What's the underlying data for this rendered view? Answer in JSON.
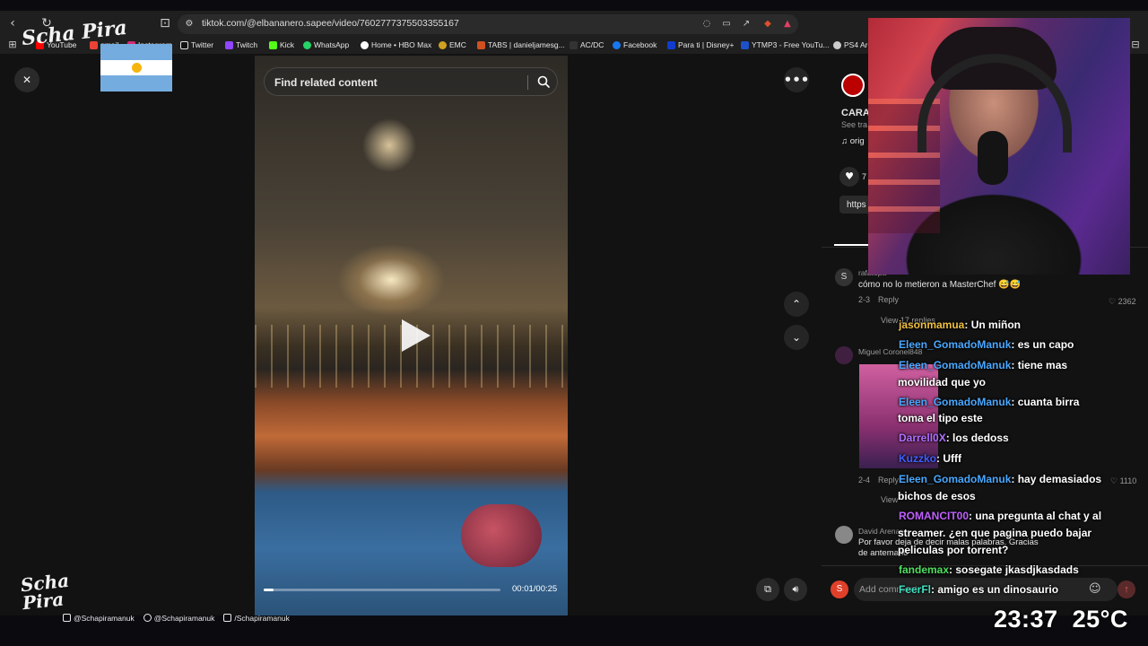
{
  "browser": {
    "url": "tiktok.com/@elbananero.sapee/video/7602777375503355167",
    "bookmarks": [
      {
        "label": "YouTube",
        "color": "#ff0000"
      },
      {
        "label": "gmail",
        "color": "#ea4335"
      },
      {
        "label": "Instagram",
        "color": "#d62976"
      },
      {
        "label": "Twitter",
        "color": "#ffffff"
      },
      {
        "label": "Twitch",
        "color": "#9146ff"
      },
      {
        "label": "Kick",
        "color": "#53fc18"
      },
      {
        "label": "WhatsApp",
        "color": "#25d366"
      },
      {
        "label": "Home • HBO Max",
        "color": "#ffffff"
      },
      {
        "label": "EMC",
        "color": "#d0a020"
      },
      {
        "label": "TABS | danieljamesg...",
        "color": "#d05020"
      },
      {
        "label": "AC/DC",
        "color": "#333333"
      },
      {
        "label": "Facebook",
        "color": "#1877f2"
      },
      {
        "label": "Para ti | Disney+",
        "color": "#113ccf"
      },
      {
        "label": "YTMP3 - Free YouTu...",
        "color": "#1e50c8"
      },
      {
        "label": "PS4 Arc",
        "color": "#cccccc"
      }
    ]
  },
  "video": {
    "search_placeholder": "Find related content",
    "time": "00:01/00:25",
    "progress": 0.04
  },
  "sidebar": {
    "creator_title": "CARA",
    "see_translation": "See tra",
    "sound": "orig",
    "likes_partial": "7",
    "link_partial": "https"
  },
  "comments": [
    {
      "user": "rafatopa",
      "avatar_letter": "S",
      "text": "cómo no lo metieron a MasterChef 😅😅",
      "meta": "2-3",
      "reply": "Reply",
      "likes": "2362",
      "view_replies": "View 17 replies"
    },
    {
      "user": "Miguel Coronel848",
      "meta": "2-4",
      "reply": "Reply",
      "likes": "1110",
      "view_replies": "View"
    },
    {
      "user": "David Arenas",
      "text": "Por favor deja de decir malas palabras. Gracias de antemano"
    }
  ],
  "add_comment_placeholder": "Add comment...",
  "add_comment_avatar": "S",
  "chat": [
    {
      "user": "jasonmamua",
      "color": "#f0c040",
      "text": ": Un miñon"
    },
    {
      "user": "Eleen_GomadoManuk",
      "color": "#4aa8ff",
      "text": ": es un capo"
    },
    {
      "user": "Eleen_GomadoManuk",
      "color": "#4aa8ff",
      "text": ": tiene mas"
    },
    {
      "user": "",
      "color": "#ffffff",
      "text": "movilidad que yo"
    },
    {
      "user": "Eleen_GomadoManuk",
      "color": "#4aa8ff",
      "text": ": cuanta birra"
    },
    {
      "user": "",
      "color": "#ffffff",
      "text": "toma el tipo este"
    },
    {
      "user": "Darrell0X",
      "color": "#b070ff",
      "text": ": los dedoss"
    },
    {
      "user": "Kuzzko",
      "color": "#4060ff",
      "text": ": Ufff"
    },
    {
      "user": "Eleen_GomadoManuk",
      "color": "#4aa8ff",
      "text": ": hay demasiados"
    },
    {
      "user": "",
      "color": "#ffffff",
      "text": "bichos de esos"
    },
    {
      "user": "ROMANCIT00",
      "color": "#c060ff",
      "text": ": una pregunta al chat y al"
    },
    {
      "user": "",
      "color": "#ffffff",
      "text": "streamer. ¿en que pagina puedo bajar"
    },
    {
      "user": "",
      "color": "#ffffff",
      "text": "peliculas por torrent?"
    },
    {
      "user": "fandemax",
      "color": "#50e060",
      "text": ": sosegate jkasdjkasdads"
    },
    {
      "user": "FeerFl",
      "color": "#40e0c0",
      "text": ": amigo es un dinosaurio"
    }
  ],
  "overlay": {
    "logo_text": "Scha Pira",
    "clock": "23:37",
    "temperature": "25°C",
    "socials": [
      "@Schapiramanuk",
      "@Schapiramanuk",
      "/Schapiramanuk"
    ]
  }
}
